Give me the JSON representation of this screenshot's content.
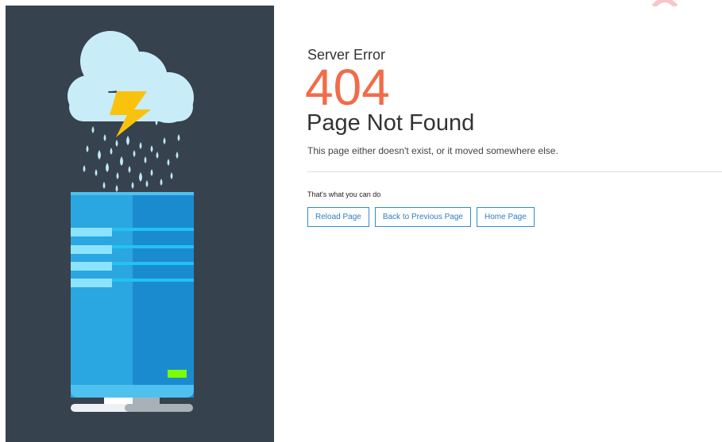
{
  "error": {
    "label": "Server Error",
    "code": "404",
    "title": "Page Not Found",
    "description": "This page either doesn't exist, or it moved somewhere else."
  },
  "actions": {
    "hint": "That's what you can do",
    "buttons": [
      {
        "label": "Reload Page"
      },
      {
        "label": "Back to Previous Page"
      },
      {
        "label": "Home Page"
      }
    ]
  },
  "illustration": {
    "icons": [
      "cloud-icon",
      "lightning-icon",
      "rain-icon",
      "server-icon"
    ],
    "colors": {
      "panel": "#37424f",
      "cloud": "#c9ecf9",
      "lightning": "#f9c20c",
      "rain": "#bfe8f8",
      "server_light": "#2aa7e0",
      "server_dark": "#1b8bd0",
      "status_led": "#7cfc00"
    }
  },
  "theme": {
    "accent": "#f26b4a",
    "button_border": "#2d8fcf"
  }
}
